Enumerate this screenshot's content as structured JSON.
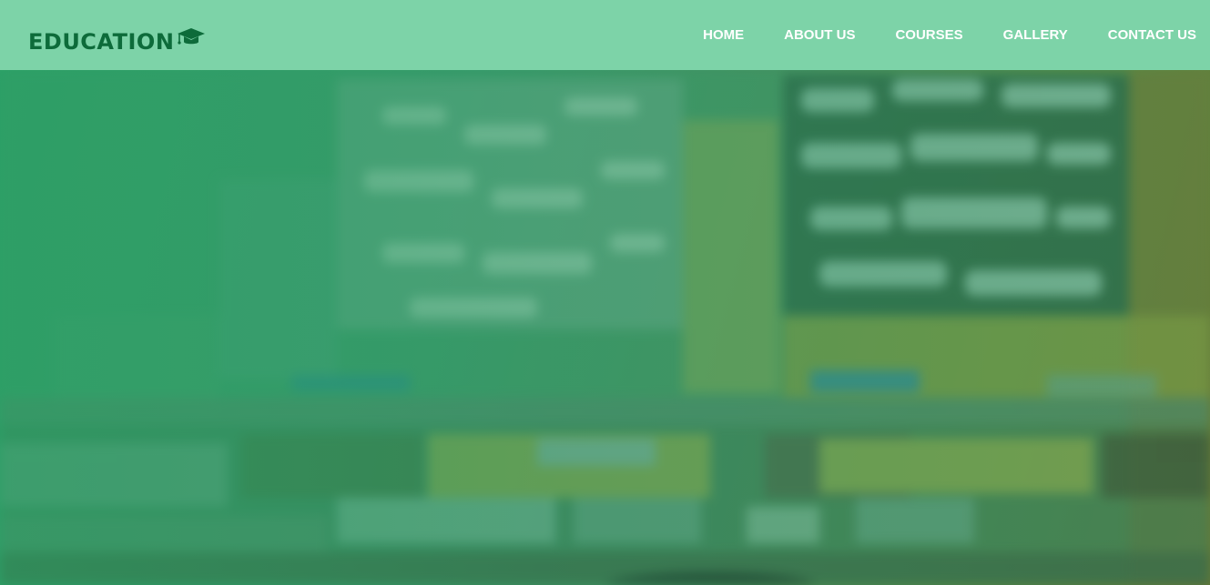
{
  "brand": {
    "name": "EDUCATION",
    "icon": "graduation-cap-icon"
  },
  "nav": {
    "items": [
      {
        "label": "HOME"
      },
      {
        "label": "ABOUT US"
      },
      {
        "label": "COURSES"
      },
      {
        "label": "GALLERY"
      },
      {
        "label": "CONTACT US"
      }
    ]
  },
  "colors": {
    "navbar_bg": "#7dd3a8",
    "brand_text": "#0d6b3a",
    "nav_text": "#ffffff",
    "hero_tint": "#2fa06a"
  }
}
